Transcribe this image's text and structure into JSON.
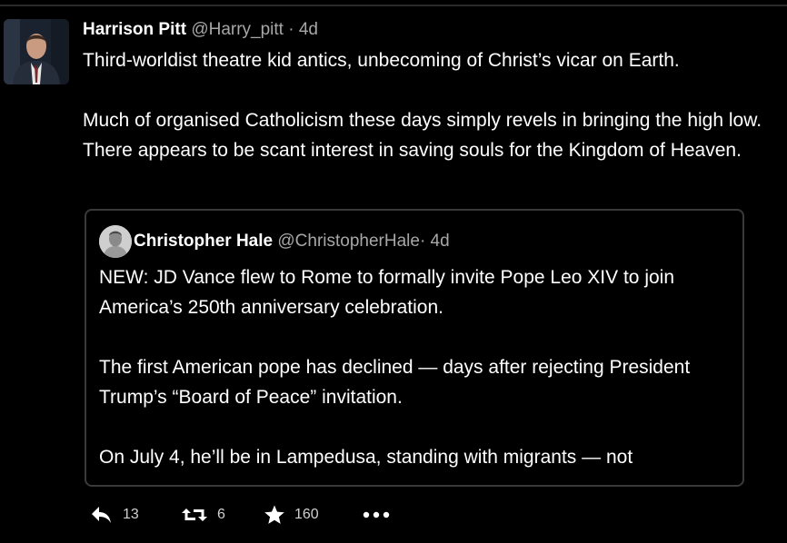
{
  "tweet": {
    "author_name": "Harrison Pitt",
    "author_handle": "@Harry_pitt",
    "timestamp": "· 4d",
    "paragraphs": [
      "Third-worldist theatre kid antics, unbecoming of Christ’s vicar on Earth.",
      "Much of organised Catholicism these days simply revels in bringing the high low. There appears to be scant interest in saving souls for the Kingdom of Heaven."
    ]
  },
  "quoted_tweet": {
    "author_name": "Christopher Hale",
    "author_handle": "@ChristopherHale",
    "timestamp": "· 4d",
    "paragraphs": [
      "NEW: JD Vance flew to Rome to formally invite Pope Leo XIV to join America’s 250th anniversary celebration.",
      "The first American pope has declined — days after rejecting President Trump’s “Board of Peace” invitation.",
      "On July 4, he’ll be in Lampedusa, standing with migrants — not"
    ]
  },
  "actions": {
    "reply_count": "13",
    "retweet_count": "6",
    "like_count": "160",
    "icons": [
      "reply-icon",
      "retweet-icon",
      "star-icon",
      "more-icon"
    ]
  },
  "colors": {
    "background": "#000000",
    "text": "#ffffff",
    "muted": "#a7a7a7",
    "border": "#3a3a3a"
  }
}
